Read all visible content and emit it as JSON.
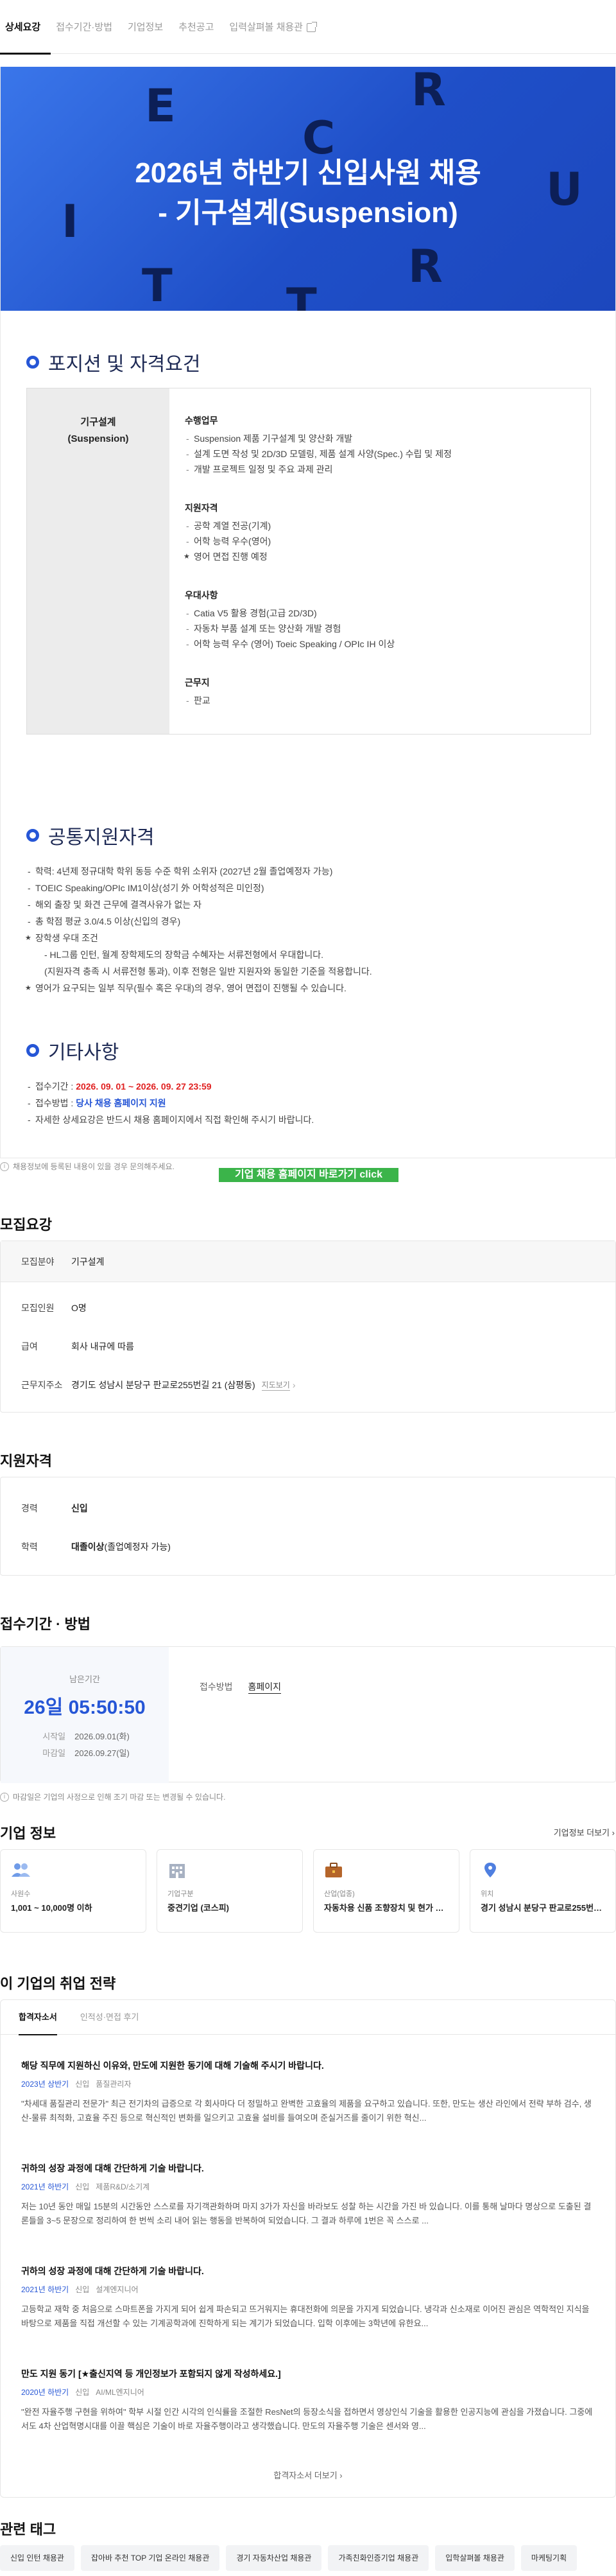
{
  "tabs": [
    {
      "label": "상세요강"
    },
    {
      "label": "접수기간·방법"
    },
    {
      "label": "기업정보"
    },
    {
      "label": "추천공고"
    },
    {
      "label": "입력살펴볼 채용관"
    }
  ],
  "hero": {
    "title_line1": "2026년 하반기 신입사원 채용",
    "title_line2": "- 기구설계(Suspension)",
    "deco_letters": [
      "E",
      "R",
      "C",
      "I",
      "U",
      "T",
      "R",
      "T"
    ]
  },
  "position": {
    "section_title": "포지션 및 자격요건",
    "role_line1": "기구설계",
    "role_line2": "(Suspension)",
    "groups": [
      {
        "title": "수행업무",
        "items": [
          "Suspension 제품 기구설계 및 양산화 개발",
          "설계 도면 작성 및 2D/3D 모델링, 제품 설계 사양(Spec.) 수립 및 제정",
          "개발 프로젝트 일정 및 주요 과제 관리"
        ],
        "stars": []
      },
      {
        "title": "지원자격",
        "items": [
          "공학 계열 전공(기계)",
          "어학 능력 우수(영어)",
          "영어 면접 진행 예정"
        ],
        "stars": [
          2
        ]
      },
      {
        "title": "우대사항",
        "items": [
          "Catia V5 활용 경험(고급 2D/3D)",
          "자동차 부품 설계 또는 양산화 개발 경험",
          "어학 능력 우수 (영어) Toeic Speaking / OPIc IH 이상"
        ],
        "stars": []
      },
      {
        "title": "근무지",
        "items": [
          "판교"
        ],
        "stars": []
      }
    ]
  },
  "common": {
    "section_title": "공통지원자격",
    "lines": [
      {
        "text": "학력: 4년제 정규대학 학위 동등 수준 학위 소위자 (2027년 2월 졸업예정자 가능)",
        "star": false,
        "sub": false
      },
      {
        "text": "TOEIC Speaking/OPIc IM1이상(성기 外 어학성적은 미인정)",
        "star": false,
        "sub": false
      },
      {
        "text": "해외 출장 및 화견 근무에 결격사유가 없는 자",
        "star": false,
        "sub": false
      },
      {
        "text": "총 학점 평균 3.0/4.5 이상(신입의 경우)",
        "star": false,
        "sub": false
      },
      {
        "text": "장학생 우대 조건",
        "star": true,
        "sub": false
      },
      {
        "text": "- HL그룹 인턴, 월계 장학제도의 장학금 수혜자는 서류전형에서 우대합니다.",
        "star": false,
        "sub": true
      },
      {
        "text": "(지원자격 충족 시 서류전형 통과), 이후 전형은 일반 지원자와 동일한 기준을 적용합니다.",
        "star": false,
        "sub": true
      },
      {
        "text": "영어가 요구되는 일부 직무(필수 혹은 우대)의 경우, 영어 면접이 진행될 수 있습니다.",
        "star": true,
        "sub": false
      }
    ]
  },
  "other": {
    "section_title": "기타사항",
    "period_label": "접수기간 : ",
    "period_value": "2026. 09. 01 ~ 2026. 09. 27  23:59",
    "method_label": "접수방법 : ",
    "method_value": "당사 채용 홈페이지 지원",
    "note": "자세한 상세요강은 반드시 채용 홈페이지에서 직접 확인해 주시기 바랍니다.",
    "apply_button": "기업 채용 홈페이지 바로가기 click"
  },
  "notice1": "채용정보에 등록된 내용이 있을 경우 문의해주세요.",
  "summary": {
    "title": "모집요강",
    "rows": [
      {
        "k": "모집분야",
        "v": "기구설계"
      },
      {
        "k": "모집인원",
        "v": "O명"
      },
      {
        "k": "급여",
        "v": "회사 내규에 따름"
      },
      {
        "k": "근무지주소",
        "v": "경기도 성남시 분당구 판교로255번길 21 (삼평동)"
      }
    ],
    "map_link": "지도보기"
  },
  "qualification": {
    "title": "지원자격",
    "rows": [
      {
        "k": "경력",
        "v": "신입",
        "extra": ""
      },
      {
        "k": "학력",
        "v": "대졸이상",
        "extra": " (졸업예정자 가능)"
      }
    ]
  },
  "apply": {
    "title": "접수기간 · 방법",
    "remaining_label": "남은기간",
    "remaining_value": "26일 05:50:50",
    "start_label": "시작일",
    "start_value": "2026.09.01(화)",
    "end_label": "마감일",
    "end_value": "2026.09.27(일)",
    "method_label": "접수방법",
    "method_value": "홈페이지",
    "notice": "마감일은 기업의 사정으로 인해 조기 마감 또는 변경될 수 있습니다."
  },
  "company": {
    "title": "기업 정보",
    "more": "기업정보 더보기",
    "cards": [
      {
        "k": "사원수",
        "v": "1,001 ~ 10,000명 이하",
        "icon": "people-icon"
      },
      {
        "k": "기업구분",
        "v": "중견기업 (코스피)",
        "icon": "building-icon"
      },
      {
        "k": "산업(업종)",
        "v": "자동차용 신품 조향장치 및 현가 장치 제조업",
        "icon": "briefcase-icon"
      },
      {
        "k": "위치",
        "v": "경기 성남시 분당구 판교로255번길 21",
        "icon": "location-icon"
      }
    ]
  },
  "strategy": {
    "title": "이 기업의 취업 전략",
    "tabs": [
      "합격자소서",
      "인적성·면접 후기"
    ],
    "items": [
      {
        "q": "해당 직무에 지원하신 이유와, 만도에 지원한 동기에 대해 기술해 주시기 바랍니다.",
        "year": "2023년 상반기",
        "type": "신입",
        "role": "품질관리자",
        "a": "\"차세대 품질관리 전문가\" 최근 전기차의 급증으로 각 회사마다 더 정밀하고 완벽한 고효율의 제품을 요구하고 있습니다. 또한, 만도는 생산 라인에서 전략 부하 검수, 생산-물류 최적화, 고효율 주진 등으로 혁신적인 변화를 일으키고 고효율 설비를 들여오며 준실거즈를 줄이기 위한 혁신..."
      },
      {
        "q": "귀하의 성장 과정에 대해 간단하게 기술 바랍니다.",
        "year": "2021년 하반기",
        "type": "신입",
        "role": "제품R&D/소기계",
        "a": "저는 10년 동안 매일 15분의 시간동안 스스로를 자기객관화하며 마지 3가가 자신을 바라보도 성찰 하는 시간을 가진 바 있습니다. 이를 통해 날마다 명상으로 도출된 결론들을 3~5 문장으로 정리하여 한 번씩 소리 내어 읽는 행동을 반복하여 되었습니다. 그 결과 하루에 1번은 꼭 스스로 ..."
      },
      {
        "q": "귀하의 성장 과정에 대해 간단하게 기술 바랍니다.",
        "year": "2021년 하반기",
        "type": "신입",
        "role": "설계엔지니어",
        "a": "고등학교 재학 중 처음으로 스마트폰을 가지게 되어 쉽게 파손되고 뜨거워지는 휴대전화에 의문을 가지게 되었습니다. 냉각과 신소재로 이어진 관심은 역학적인 지식을 바탕으로 제품을 직접 개선할 수 있는 기계공학과에 진학하게 되는 계기가 되었습니다. 입학 이후에는 3학년에 유한요..."
      },
      {
        "q": "만도 지원 동기 [★출신지역 등 개인정보가 포함되지 않게 작성하세요.]",
        "year": "2020년 하반기",
        "type": "신입",
        "role": "AI/ML엔지니어",
        "a": "\"완전 자율주행 구현을 위하여\" 학부 시절 인간 시각의 인식률을 조절한 ResNet의 등장소식을 접하면서 영상인식 기술을 활용한 인공지능에 관심을 가졌습니다. 그중에서도 4차 산업혁명시대를 이끌 핵심은 기술이 바로 자율주행이라고 생각했습니다. 만도의 자율주행 기술은 센서와 영..."
      }
    ],
    "more": "합격자소서 더보기"
  },
  "tags_section": {
    "title": "관련 태그",
    "tags": [
      "신입 인턴 채용관",
      "잡아바 추천 TOP 기업 온라인 채용관",
      "경기 자동차산업 채용관",
      "가족친화인증기업 채용관",
      "입학살펴볼 채용관",
      "마케팅기획"
    ]
  },
  "colors": {
    "accent": "#2656d6",
    "hero": "#2a5fdc",
    "apply_button": "#3bb44a",
    "deadline": "#e02020"
  }
}
